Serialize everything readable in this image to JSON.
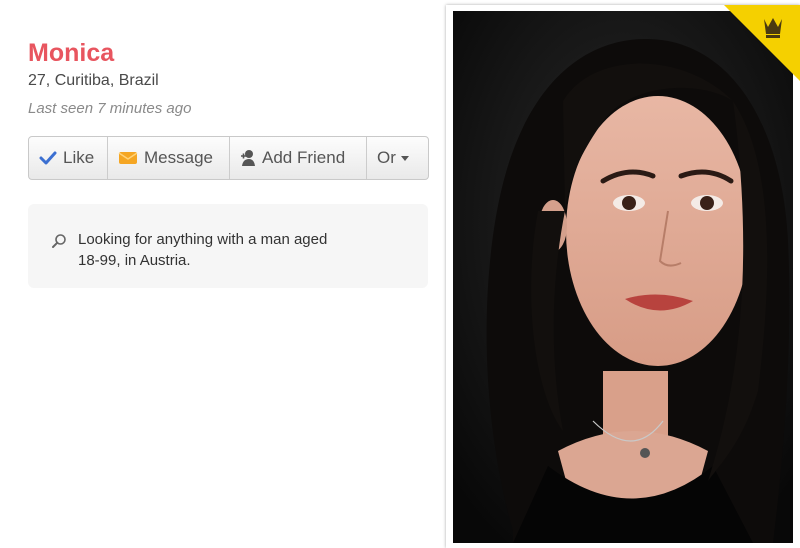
{
  "profile": {
    "name": "Monica",
    "details": "27, Curitiba, Brazil",
    "last_seen": "Last seen 7 minutes ago"
  },
  "actions": {
    "like": "Like",
    "message": "Message",
    "add_friend": "Add Friend",
    "or": "Or"
  },
  "looking_for": {
    "text": "Looking for anything with a man aged 18-99, in Austria."
  },
  "photo": {
    "icon": "crown-icon",
    "badge_color": "#f5d000"
  },
  "colors": {
    "name": "#e8555f",
    "like_check": "#3b6fd1",
    "message_envelope": "#f5a623"
  }
}
